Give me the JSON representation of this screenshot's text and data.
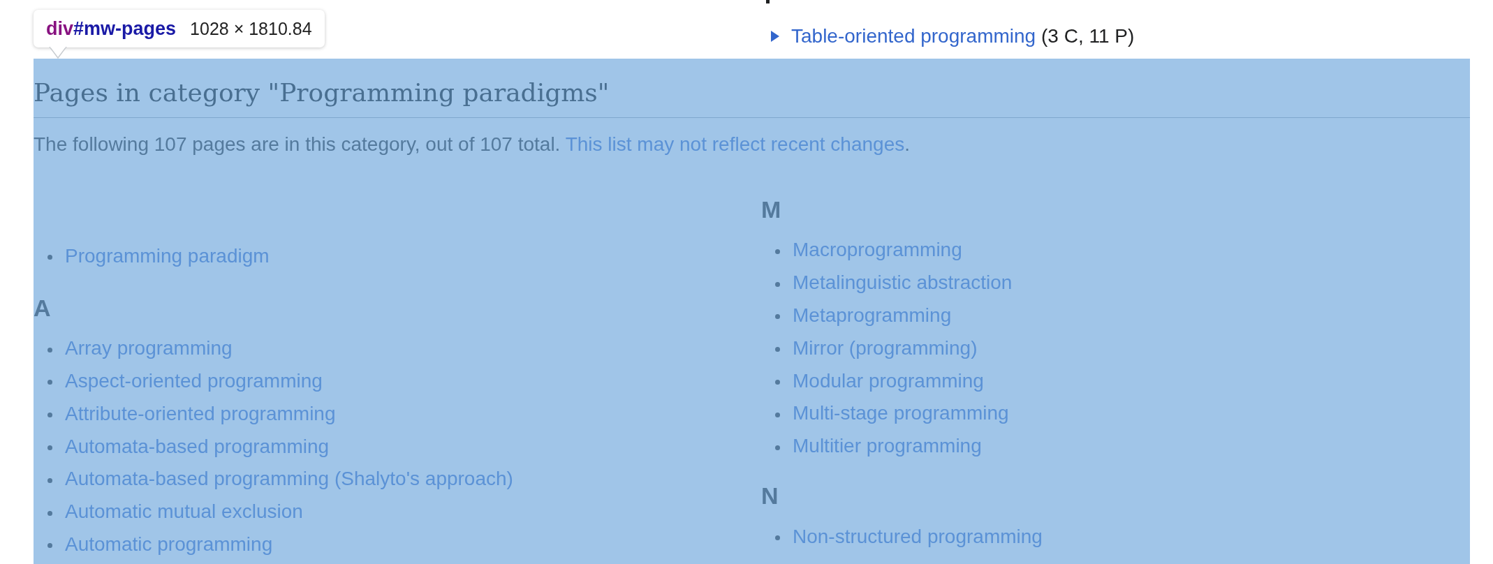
{
  "tooltip": {
    "tag": "div",
    "id": "#mw-pages",
    "size": "1028 × 1810.84"
  },
  "subcategories": [
    {
      "label": "Table-oriented programming",
      "count": "(3 C, 11 P)",
      "expanded": false
    }
  ],
  "pages_section": {
    "highlighted": true,
    "title": "Pages in category \"Programming paradigms\"",
    "summary": "The following 107 pages are in this category, out of 107 total.",
    "summary_link": "This list may not reflect recent changes",
    "summary_end": ".",
    "columns": [
      {
        "groups": [
          {
            "items": [
              "Programming paradigm"
            ]
          },
          {
            "heading": "A",
            "items": [
              "Array programming",
              "Aspect-oriented programming",
              "Attribute-oriented programming",
              "Automata-based programming",
              "Automata-based programming (Shalyto's approach)",
              "Automatic mutual exclusion",
              "Automatic programming"
            ]
          }
        ]
      },
      {
        "groups": [
          {
            "heading": "M",
            "items": [
              "Macroprogramming",
              "Metalinguistic abstraction",
              "Metaprogramming",
              "Mirror (programming)",
              "Modular programming",
              "Multi-stage programming",
              "Multitier programming"
            ]
          },
          {
            "heading": "N",
            "items": [
              "Non-structured programming"
            ]
          }
        ]
      }
    ]
  }
}
